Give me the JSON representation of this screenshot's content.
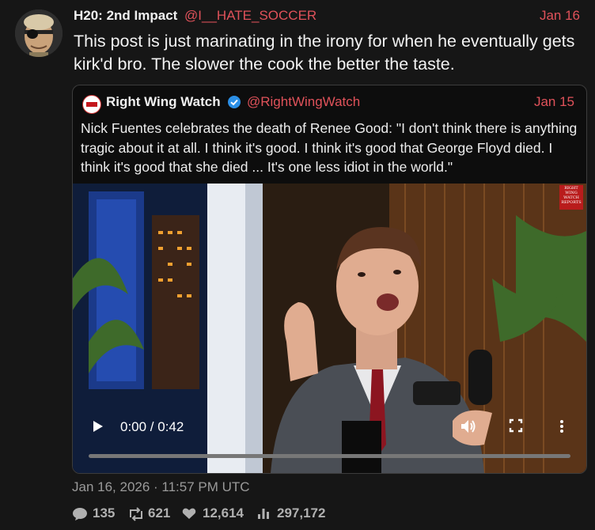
{
  "post": {
    "display_name": "H20: 2nd Impact",
    "handle": "@I__HATE_SOCCER",
    "date": "Jan 16",
    "text": "This post is just marinating in the irony for when he eventually gets kirk'd bro. The slower the cook the better the taste."
  },
  "quote": {
    "display_name": "Right Wing Watch",
    "handle": "@RightWingWatch",
    "date": "Jan 15",
    "text": "Nick Fuentes celebrates the death of Renee Good: \"I don't think there is anything tragic about it at all. I think it's good. I think it's good that George Floyd died. I think it's good that she died ... It's one less idiot in the world.\"",
    "video": {
      "time": "0:00 / 0:42",
      "progress": 0,
      "badge": "RIGHT WING WATCH REPORTS"
    }
  },
  "meta": {
    "timestamp": "Jan 16, 2026 · 11:57 PM UTC"
  },
  "stats": {
    "replies": "135",
    "reposts": "621",
    "likes": "12,614",
    "views": "297,172"
  },
  "colors": {
    "accent": "#e0525a",
    "background": "#161616",
    "verified": "#2b8fe6"
  },
  "icons": [
    "reply-icon",
    "repost-icon",
    "heart-icon",
    "views-icon",
    "play-icon",
    "volume-icon",
    "fullscreen-icon",
    "more-icon",
    "verified-icon"
  ]
}
